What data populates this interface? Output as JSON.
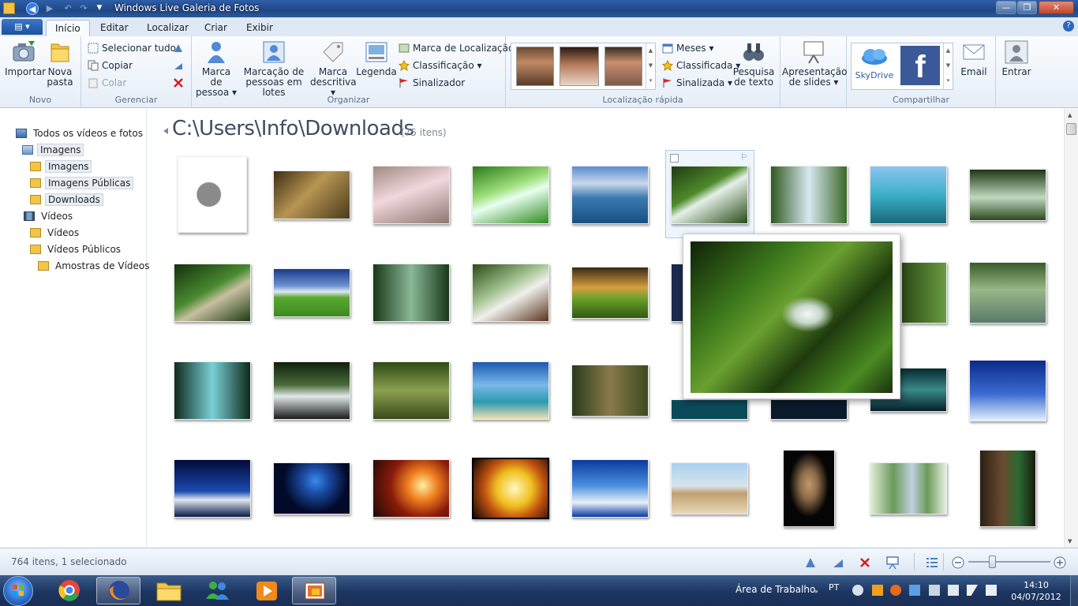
{
  "window": {
    "title": "Windows Live Galeria de Fotos"
  },
  "tabs": [
    "Início",
    "Editar",
    "Localizar",
    "Criar",
    "Exibir"
  ],
  "ribbon": {
    "novo": {
      "label": "Novo",
      "importar": "Importar",
      "nova_pasta_l1": "Nova",
      "nova_pasta_l2": "pasta"
    },
    "gerenciar": {
      "label": "Gerenciar",
      "selecionar_tudo": "Selecionar tudo",
      "copiar": "Copiar",
      "colar": "Colar"
    },
    "organizar": {
      "label": "Organizar",
      "marca_pessoa_l1": "Marca de",
      "marca_pessoa_l2": "pessoa",
      "marcacao_lotes_l1": "Marcação de",
      "marcacao_lotes_l2": "pessoas em lotes",
      "marca_descritiva_l1": "Marca",
      "marca_descritiva_l2": "descritiva",
      "legenda": "Legenda",
      "marca_localizacao": "Marca de Localização",
      "classificacao": "Classificação",
      "sinalizador": "Sinalizador"
    },
    "localizacao_rapida": {
      "label": "Localização rápida",
      "meses": "Meses",
      "classificada": "Classificada",
      "sinalizada": "Sinalizada",
      "pesquisa_l1": "Pesquisa",
      "pesquisa_l2": "de texto",
      "apresentacao_l1": "Apresentação",
      "apresentacao_l2": "de slides"
    },
    "compartilhar": {
      "label": "Compartilhar",
      "skydrive": "SkyDrive",
      "email": "Email",
      "entrar": "Entrar"
    }
  },
  "tree": {
    "all": "Todos os vídeos e fotos",
    "imagens": "Imagens",
    "imagens_sub": "Imagens",
    "imagens_publicas": "Imagens Públicas",
    "downloads": "Downloads",
    "videos": "Vídeos",
    "videos_sub": "Vídeos",
    "videos_publicos": "Vídeos Públicos",
    "amostras": "Amostras de Vídeos"
  },
  "content": {
    "path": "C:\\Users\\Info\\Downloads",
    "count": "(75 itens)"
  },
  "status": {
    "text": "764 itens, 1 selecionado"
  },
  "taskbar": {
    "desktop": "Área de Trabalho",
    "lang": "PT",
    "time": "14:10",
    "date": "04/07/2012"
  },
  "colors": {
    "ribbon_accent": "#2f5fa8",
    "selection": "#b3cbeb",
    "taskbar": "#1c3560"
  }
}
